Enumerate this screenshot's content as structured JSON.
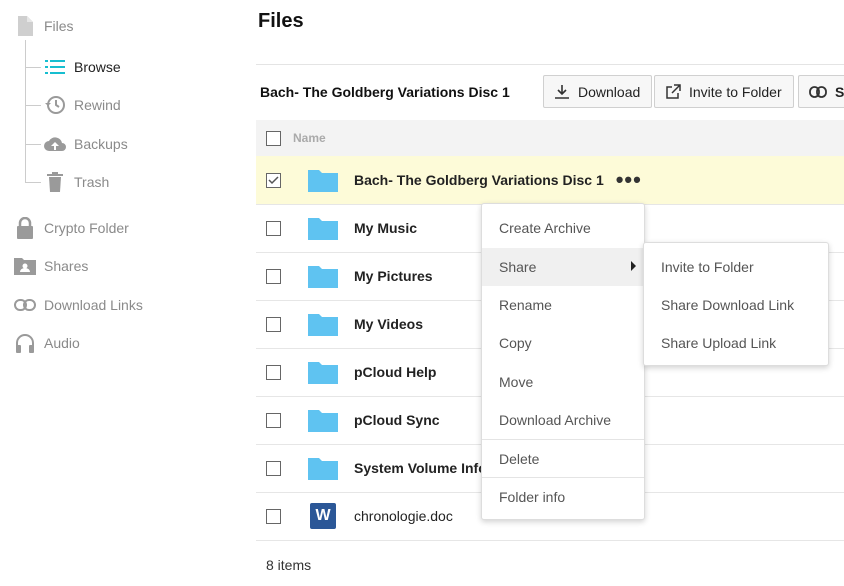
{
  "sidebar": {
    "files": "Files",
    "browse": "Browse",
    "rewind": "Rewind",
    "backups": "Backups",
    "trash": "Trash",
    "crypto": "Crypto Folder",
    "shares": "Shares",
    "download_links": "Download Links",
    "audio": "Audio"
  },
  "header": {
    "title": "Files",
    "folder_name": "Bach- The Goldberg Variations Disc 1",
    "download_label": "Download",
    "invite_label": "Invite to Folder",
    "share_partial_label": "Sh"
  },
  "table": {
    "column_name": "Name",
    "rows": [
      {
        "name": "Bach- The Goldberg Variations Disc 1",
        "type": "folder",
        "checked": true
      },
      {
        "name": "My Music",
        "type": "folder"
      },
      {
        "name": "My Pictures",
        "type": "folder"
      },
      {
        "name": "My Videos",
        "type": "folder"
      },
      {
        "name": "pCloud Help",
        "type": "folder"
      },
      {
        "name": "pCloud Sync",
        "type": "folder"
      },
      {
        "name": "System Volume Info",
        "type": "folder"
      },
      {
        "name": "chronologie.doc",
        "type": "word-doc",
        "icon_letter": "W"
      }
    ],
    "footer": "8 items"
  },
  "context_menu": {
    "items": [
      "Create Archive",
      "Share",
      "Rename",
      "Copy",
      "Move",
      "Download Archive",
      "Delete",
      "Folder info"
    ]
  },
  "share_submenu": {
    "items": [
      "Invite to Folder",
      "Share Download Link",
      "Share Upload Link"
    ]
  },
  "colors": {
    "accent": "#17bed0",
    "folder": "#5fc3f1",
    "selected_row": "#fdfbd8",
    "word": "#2b5797"
  }
}
